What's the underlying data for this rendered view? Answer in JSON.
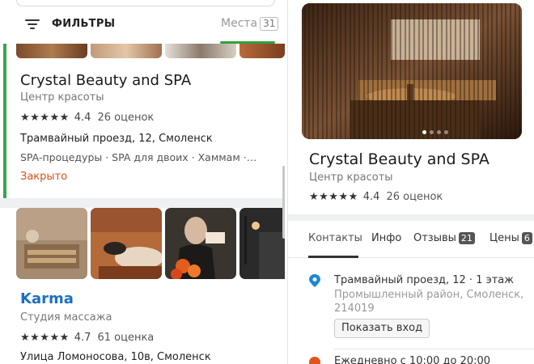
{
  "filters": {
    "label": "ФИЛЬТРЫ",
    "places_label": "Места",
    "places_count": "31"
  },
  "card1": {
    "name": "Crystal Beauty and SPA",
    "category": "Центр красоты",
    "stars": "★★★★★",
    "rating": "4.4",
    "reviews": "26 оценок",
    "address": "Трамвайный проезд, 12, Смоленск",
    "tags": "SPA-процедуры · SPA для двоих · Хаммам ·…",
    "status": "Закрыто",
    "status_color": "#d9501a"
  },
  "card2": {
    "name": "Karma",
    "name_color": "#1b70c2",
    "category": "Студия массажа",
    "stars": "★★★★★",
    "rating": "4.7",
    "reviews": "61 оценка",
    "address": "Улица Ломоносова, 10в, Смоленск"
  },
  "detail": {
    "name": "Crystal Beauty and SPA",
    "category": "Центр красоты",
    "stars": "★★★★★",
    "rating": "4.4",
    "reviews": "26 оценок",
    "tabs": [
      {
        "label": "Контакты"
      },
      {
        "label": "Инфо"
      },
      {
        "label": "Отзывы",
        "count": "21"
      },
      {
        "label": "Цены",
        "count": "6"
      }
    ],
    "address_main": "Трамвайный проезд, 12 · 1 этаж",
    "address_area": "Промышленный район, Смоленск, 214019",
    "entrance_button": "Показать вход",
    "hours": "Ежедневно с 10:00 до 20:00"
  },
  "icons": [
    "filter-icon",
    "map-pin-icon",
    "clock-icon"
  ],
  "colors": {
    "accent_green": "#3aa54a",
    "pin_blue": "#1e88d6"
  }
}
